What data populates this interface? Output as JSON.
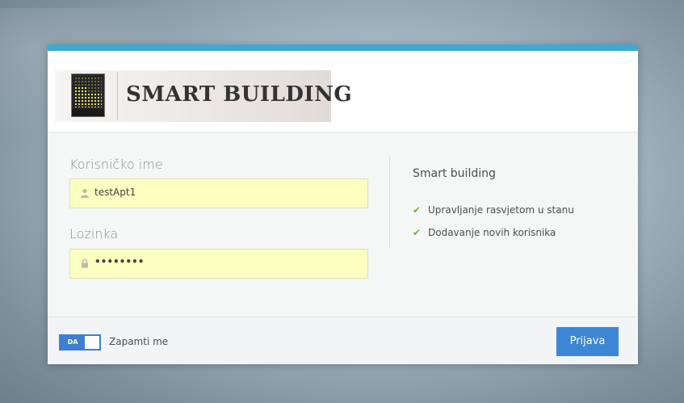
{
  "brand": {
    "logo_text": "SMART BUILDING"
  },
  "form": {
    "username_label": "Korisničko ime",
    "username_value": "testApt1",
    "password_label": "Lozinka",
    "password_value": "••••••••"
  },
  "info": {
    "title": "Smart building",
    "features": [
      {
        "label": "Upravljanje rasvjetom u stanu",
        "icon": "check-icon"
      },
      {
        "label": "Dodavanje novih korisnika",
        "icon": "check-icon"
      }
    ]
  },
  "footer": {
    "toggle_state": "DA",
    "remember_label": "Zapamti me",
    "login_button": "Prijava"
  },
  "colors": {
    "accent_bar": "#3fa9d3",
    "primary_button": "#3d86d6",
    "input_autofill": "#fbffbf",
    "check": "#6ab04c"
  },
  "icons": {
    "username": "user-icon",
    "password": "lock-icon"
  }
}
